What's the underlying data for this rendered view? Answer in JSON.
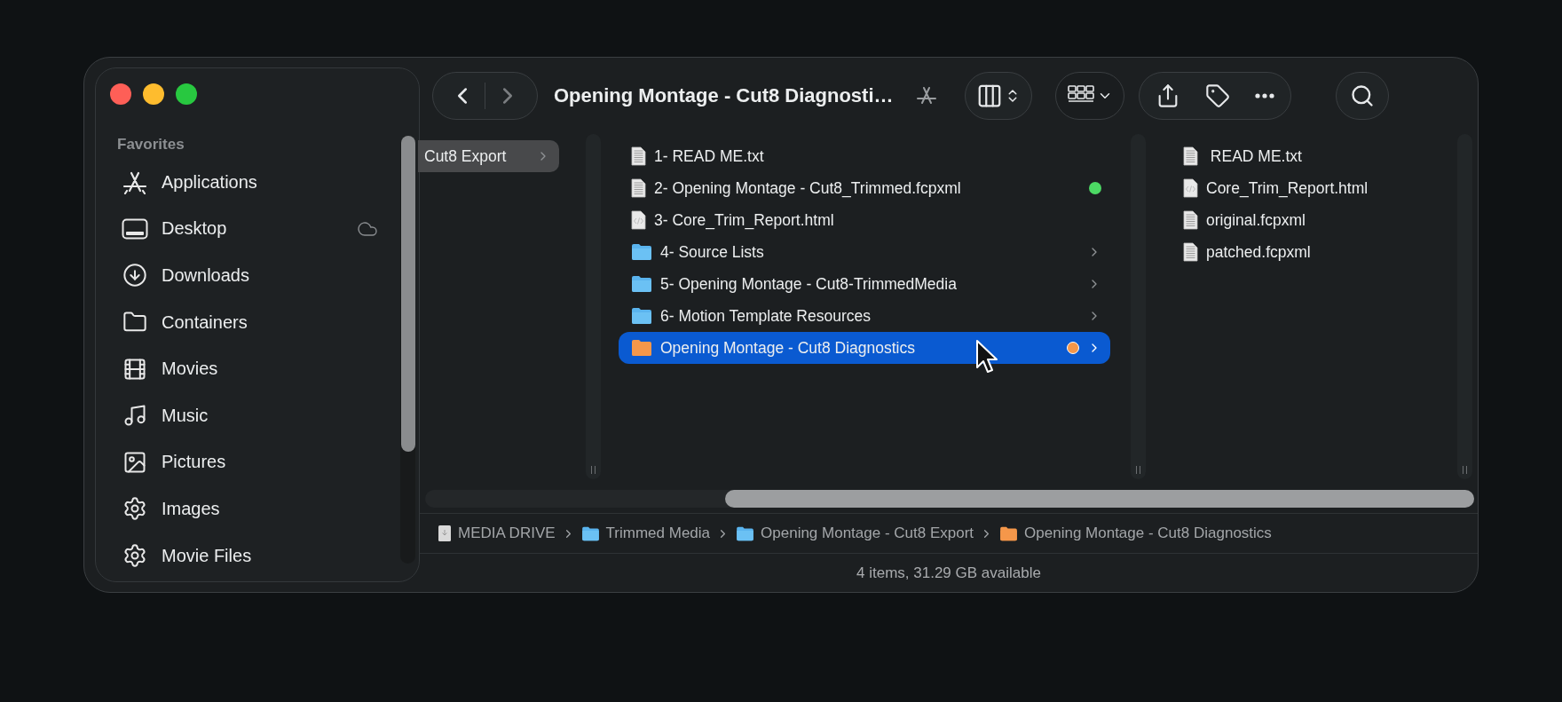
{
  "window": {
    "title": "Opening Montage - Cut8 Diagnosti…"
  },
  "nav": {
    "back_disabled": false,
    "forward_disabled": true
  },
  "sidebar": {
    "section": "Favorites",
    "items": [
      {
        "label": "Applications",
        "kind": "apps",
        "cloud": false
      },
      {
        "label": "Desktop",
        "kind": "desktop",
        "cloud": true
      },
      {
        "label": "Downloads",
        "kind": "downloads",
        "cloud": false
      },
      {
        "label": "Containers",
        "kind": "folder",
        "cloud": false
      },
      {
        "label": "Movies",
        "kind": "film",
        "cloud": false
      },
      {
        "label": "Music",
        "kind": "music",
        "cloud": false
      },
      {
        "label": "Pictures",
        "kind": "pictures",
        "cloud": false
      },
      {
        "label": "Images",
        "kind": "gear",
        "cloud": false
      },
      {
        "label": "Movie Files",
        "kind": "gear",
        "cloud": false
      }
    ]
  },
  "columns": [
    {
      "items": [
        {
          "label": "Cut8 Export",
          "kind": "folder",
          "selected": true
        }
      ]
    },
    {
      "items": [
        {
          "label": "1- READ ME.txt",
          "kind": "text",
          "selected": false
        },
        {
          "label": "2- Opening Montage - Cut8_Trimmed.fcpxml",
          "kind": "text",
          "selected": false,
          "color": "#4cd964"
        },
        {
          "label": "3- Core_Trim_Report.html",
          "kind": "html",
          "selected": false
        },
        {
          "label": "4- Source Lists",
          "kind": "folder",
          "selected": false
        },
        {
          "label": "5- Opening Montage - Cut8-TrimmedMedia",
          "kind": "folder",
          "selected": false
        },
        {
          "label": "6- Motion Template Resources",
          "kind": "folder",
          "selected": false
        },
        {
          "label": "Opening Montage - Cut8 Diagnostics",
          "kind": "folder",
          "selected": true,
          "color": "#f5974a"
        }
      ]
    },
    {
      "items": [
        {
          "label": " READ ME.txt",
          "kind": "text",
          "selected": false
        },
        {
          "label": "Core_Trim_Report.html",
          "kind": "html",
          "selected": false
        },
        {
          "label": "original.fcpxml",
          "kind": "text",
          "selected": false
        },
        {
          "label": "patched.fcpxml",
          "kind": "text",
          "selected": false
        }
      ]
    }
  ],
  "path": [
    {
      "label": "MEDIA DRIVE",
      "kind": "drive"
    },
    {
      "label": "Trimmed Media",
      "kind": "folder"
    },
    {
      "label": "Opening Montage - Cut8 Export",
      "kind": "folder"
    },
    {
      "label": "Opening Montage - Cut8 Diagnostics",
      "kind": "folder",
      "color": "#f5974a"
    }
  ],
  "status": "4 items, 31.29 GB available"
}
